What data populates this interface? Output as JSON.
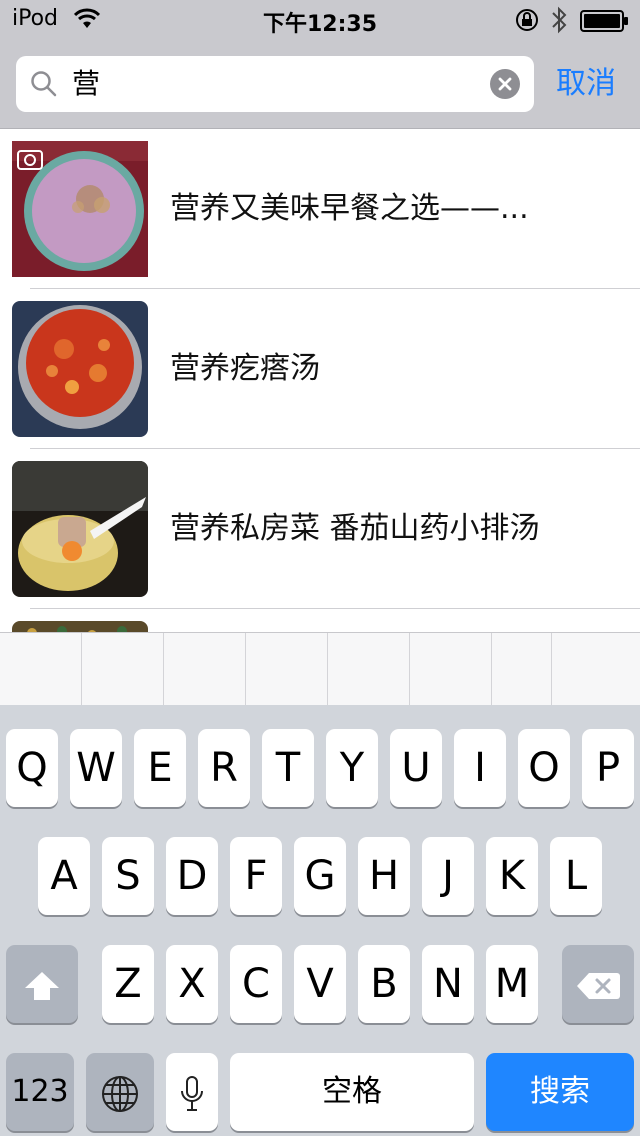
{
  "status_bar": {
    "carrier": "iPod",
    "time": "下午12:35"
  },
  "search": {
    "query": "营",
    "cancel_label": "取消"
  },
  "results": [
    {
      "title": "营养又美味早餐之选——..."
    },
    {
      "title": "营养疙瘩汤"
    },
    {
      "title": "营养私房菜 番茄山药小排汤"
    }
  ],
  "keyboard": {
    "row1": [
      "Q",
      "W",
      "E",
      "R",
      "T",
      "Y",
      "U",
      "I",
      "O",
      "P"
    ],
    "row2": [
      "A",
      "S",
      "D",
      "F",
      "G",
      "H",
      "J",
      "K",
      "L"
    ],
    "row3": [
      "Z",
      "X",
      "C",
      "V",
      "B",
      "N",
      "M"
    ],
    "numbers_label": "123",
    "space_label": "空格",
    "search_label": "搜索"
  },
  "colors": {
    "accent": "#1a7dff",
    "search_key": "#1f86ff",
    "bar_background": "#c9c9ce",
    "keyboard_background": "#d1d5db"
  }
}
